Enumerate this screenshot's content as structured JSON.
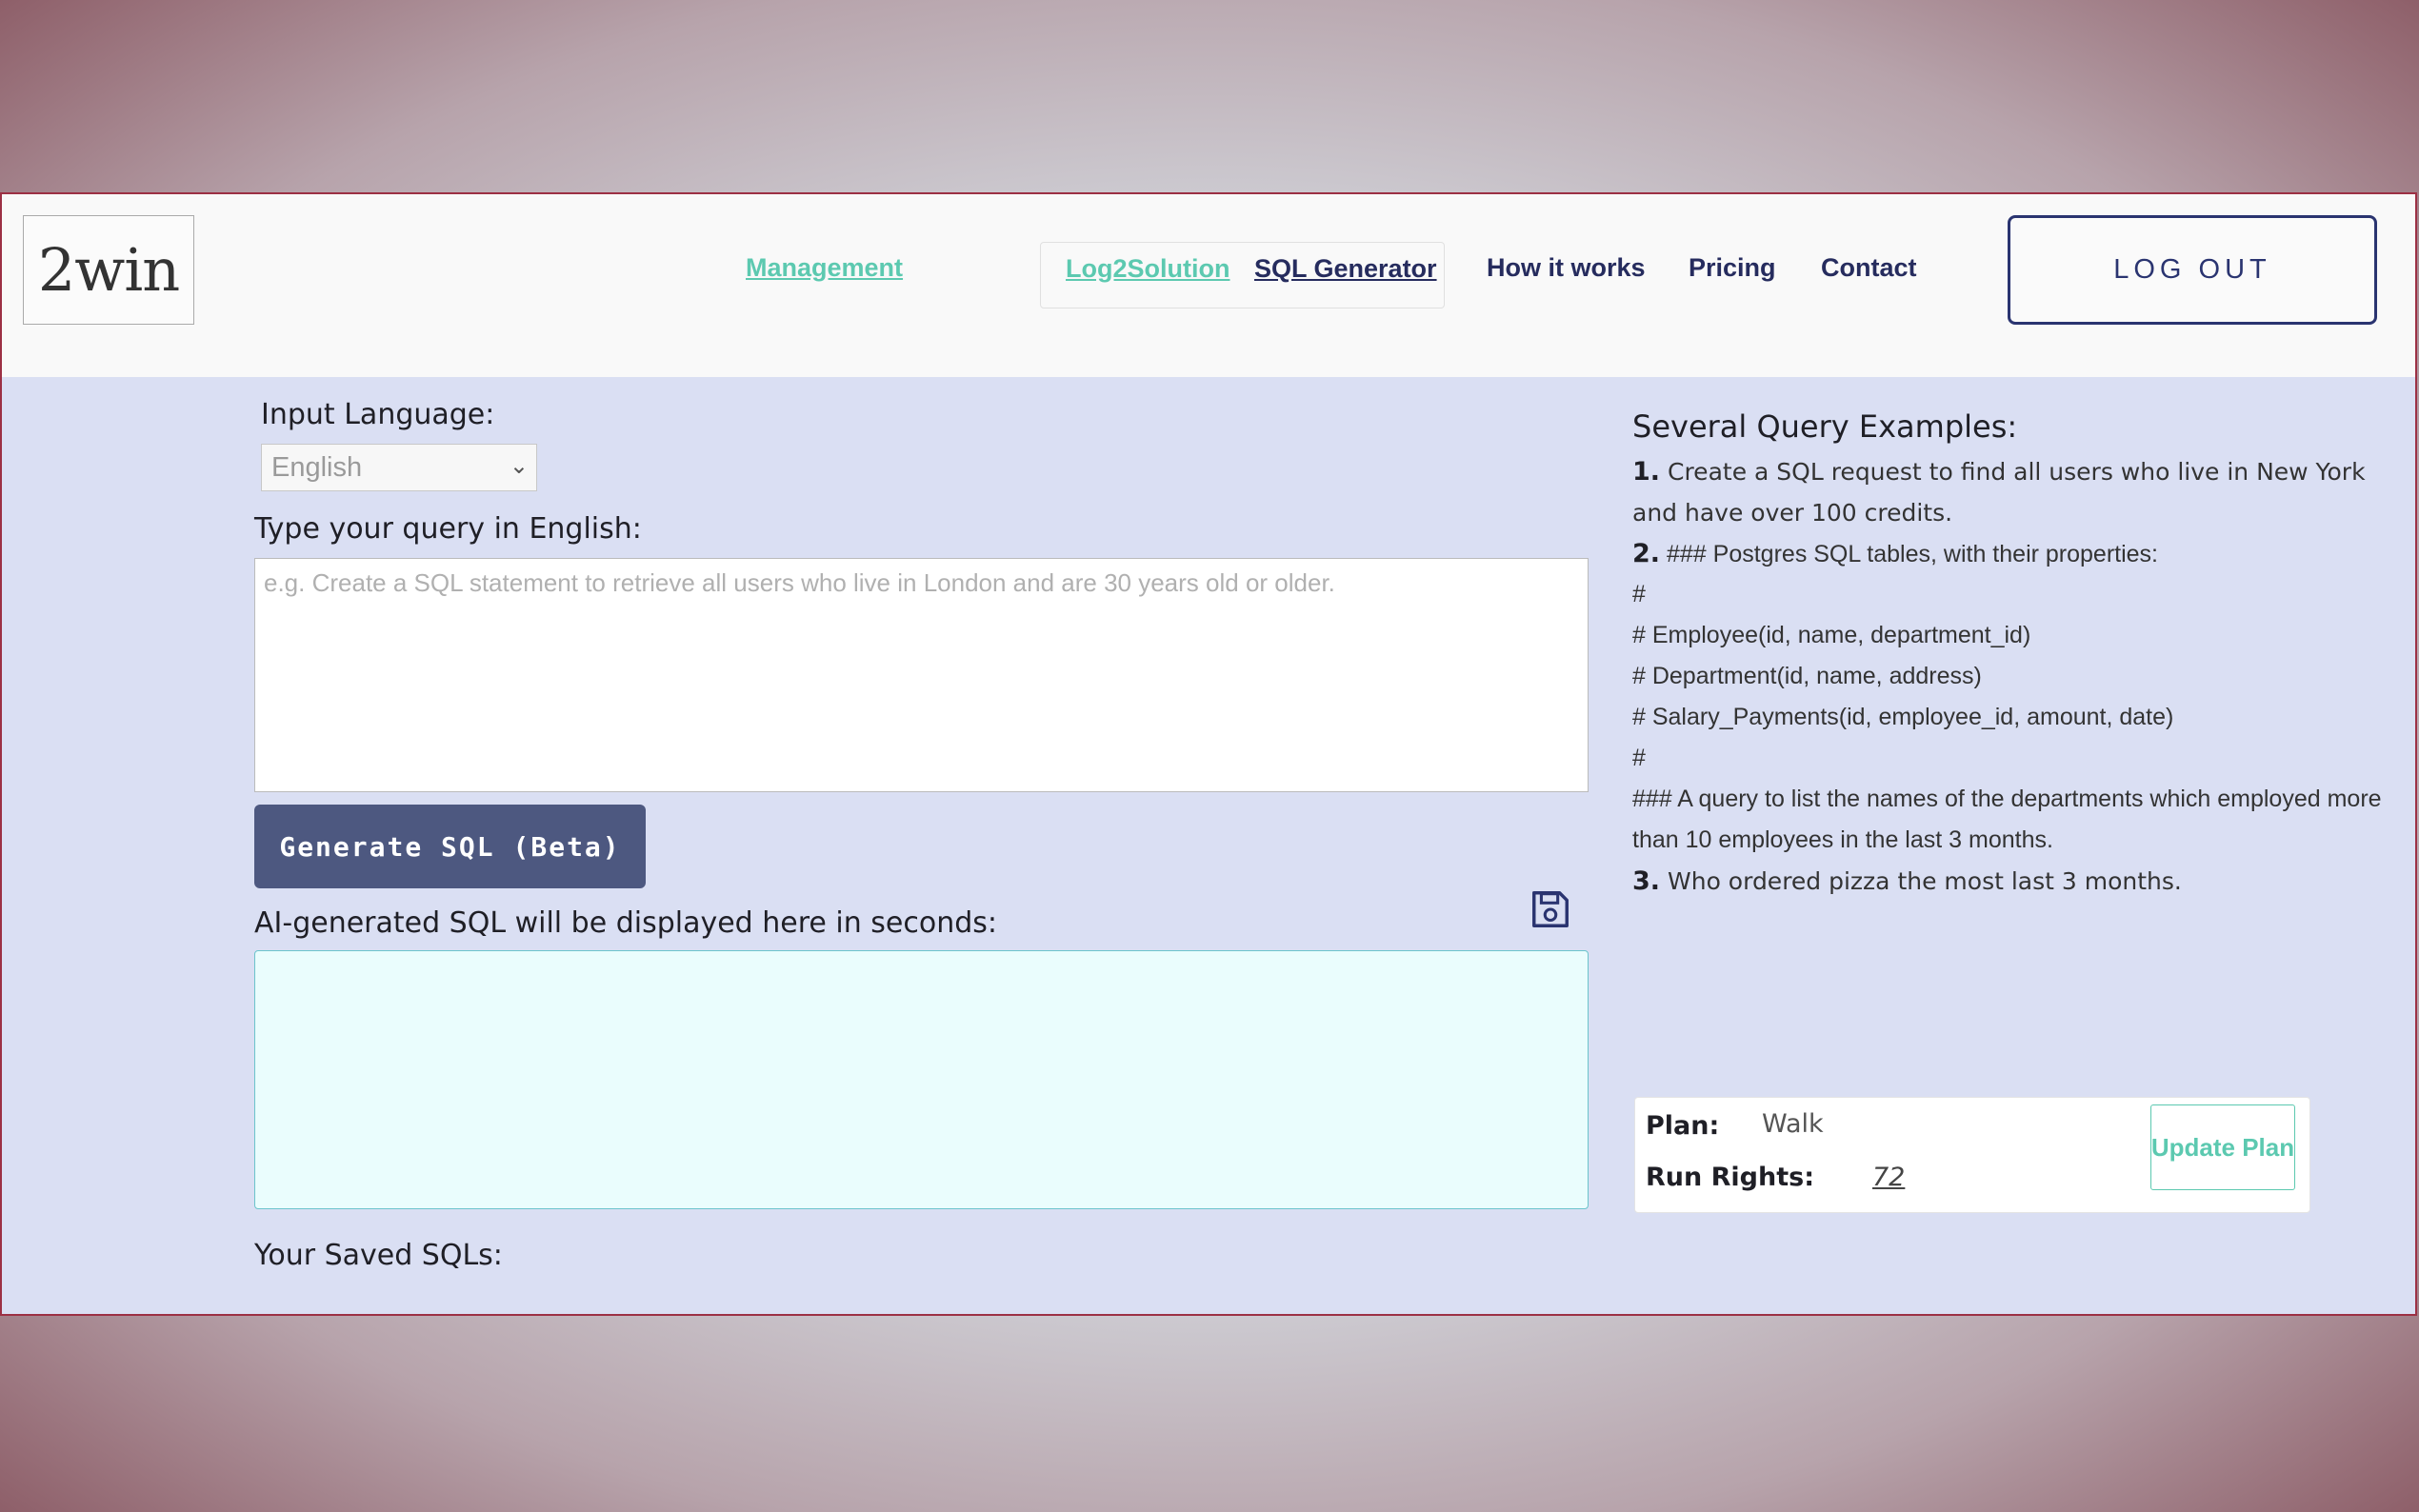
{
  "header": {
    "logo_text": "2win",
    "nav": {
      "management": "Management",
      "log2solution": "Log2Solution",
      "sql_generator": "SQL Generator",
      "how_it_works": "How it works",
      "pricing": "Pricing",
      "contact": "Contact"
    },
    "logout_label": "LOG OUT"
  },
  "form": {
    "input_language_label": "Input Language:",
    "language_selected": "English",
    "query_label": "Type your query in English:",
    "query_placeholder": "e.g. Create a SQL statement to retrieve all users who live in London and are 30 years old or older.",
    "generate_label": "Generate SQL (Beta)",
    "output_label": "AI-generated SQL will be displayed here in seconds:",
    "saved_label": "Your Saved SQLs:"
  },
  "examples": {
    "title": "Several Query Examples:",
    "ex1_num": "1.",
    "ex1_line1": "Create a SQL request to find all users who live in New York",
    "ex1_line2": "and have over 100 credits.",
    "ex2_num": "2.",
    "ex2_lines": [
      "### Postgres SQL tables, with their properties:",
      "#",
      "# Employee(id, name, department_id)",
      "# Department(id, name, address)",
      "# Salary_Payments(id, employee_id, amount, date)",
      "#",
      "### A query to list the names of the departments which employed more",
      "than 10 employees in the last 3 months."
    ],
    "ex3_num": "3.",
    "ex3_line": "Who ordered pizza the most last 3 months."
  },
  "plan": {
    "plan_label": "Plan:",
    "plan_value": "Walk",
    "rights_label": "Run Rights:",
    "rights_value": "72",
    "update_label": "Update Plan"
  },
  "colors": {
    "accent_teal": "#5cc9b0",
    "navy": "#2a3470",
    "button": "#4d5880",
    "background": "#dadff3"
  }
}
